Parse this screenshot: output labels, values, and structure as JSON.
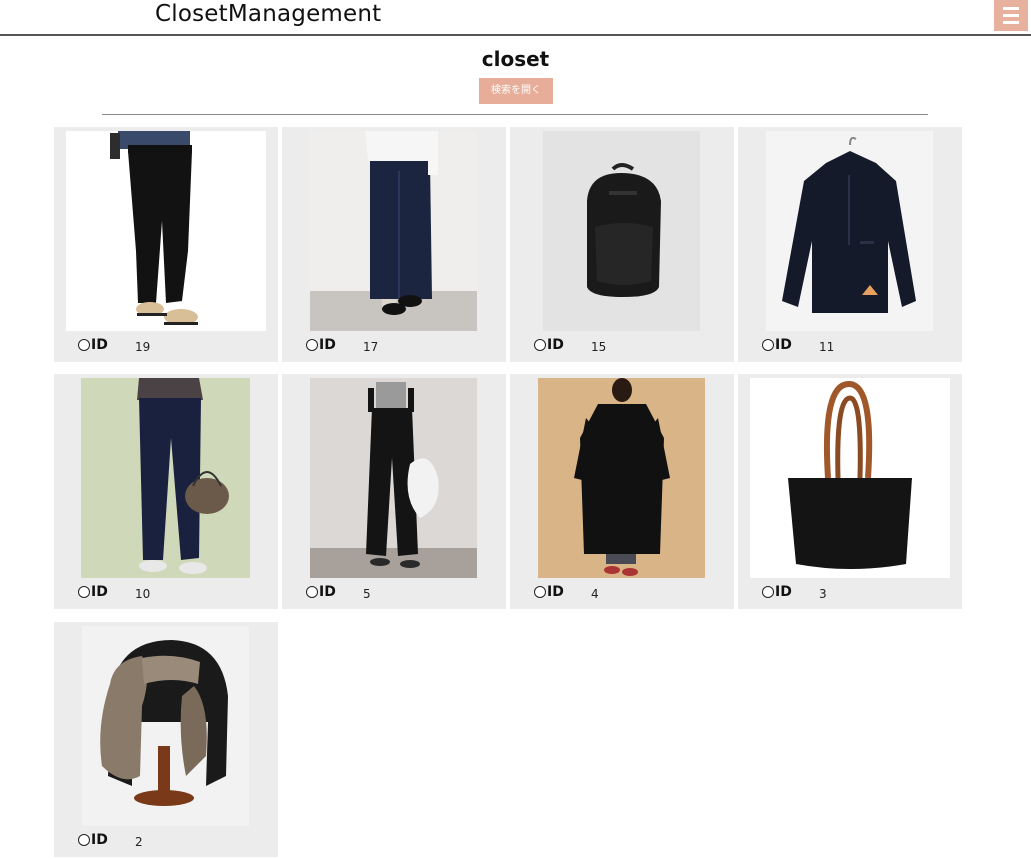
{
  "header": {
    "brand": "ClosetManagement",
    "menu_icon": "hamburger-menu-icon"
  },
  "page": {
    "title": "closet",
    "search_button_label": "検索を開く"
  },
  "colors": {
    "accent": "#e7b19d",
    "card_bg": "#ececec"
  },
  "items": [
    {
      "id_label": "ID",
      "id": "19",
      "image": "black-pants-photo"
    },
    {
      "id_label": "ID",
      "id": "17",
      "image": "denim-skirt-photo"
    },
    {
      "id_label": "ID",
      "id": "15",
      "image": "black-backpack-photo"
    },
    {
      "id_label": "ID",
      "id": "11",
      "image": "black-anorak-photo"
    },
    {
      "id_label": "ID",
      "id": "10",
      "image": "denim-jeans-photo"
    },
    {
      "id_label": "ID",
      "id": "5",
      "image": "black-overalls-photo"
    },
    {
      "id_label": "ID",
      "id": "4",
      "image": "black-trench-coat-photo"
    },
    {
      "id_label": "ID",
      "id": "3",
      "image": "black-tote-bag-photo"
    },
    {
      "id_label": "ID",
      "id": "2",
      "image": "fur-trapper-hat-photo"
    }
  ]
}
